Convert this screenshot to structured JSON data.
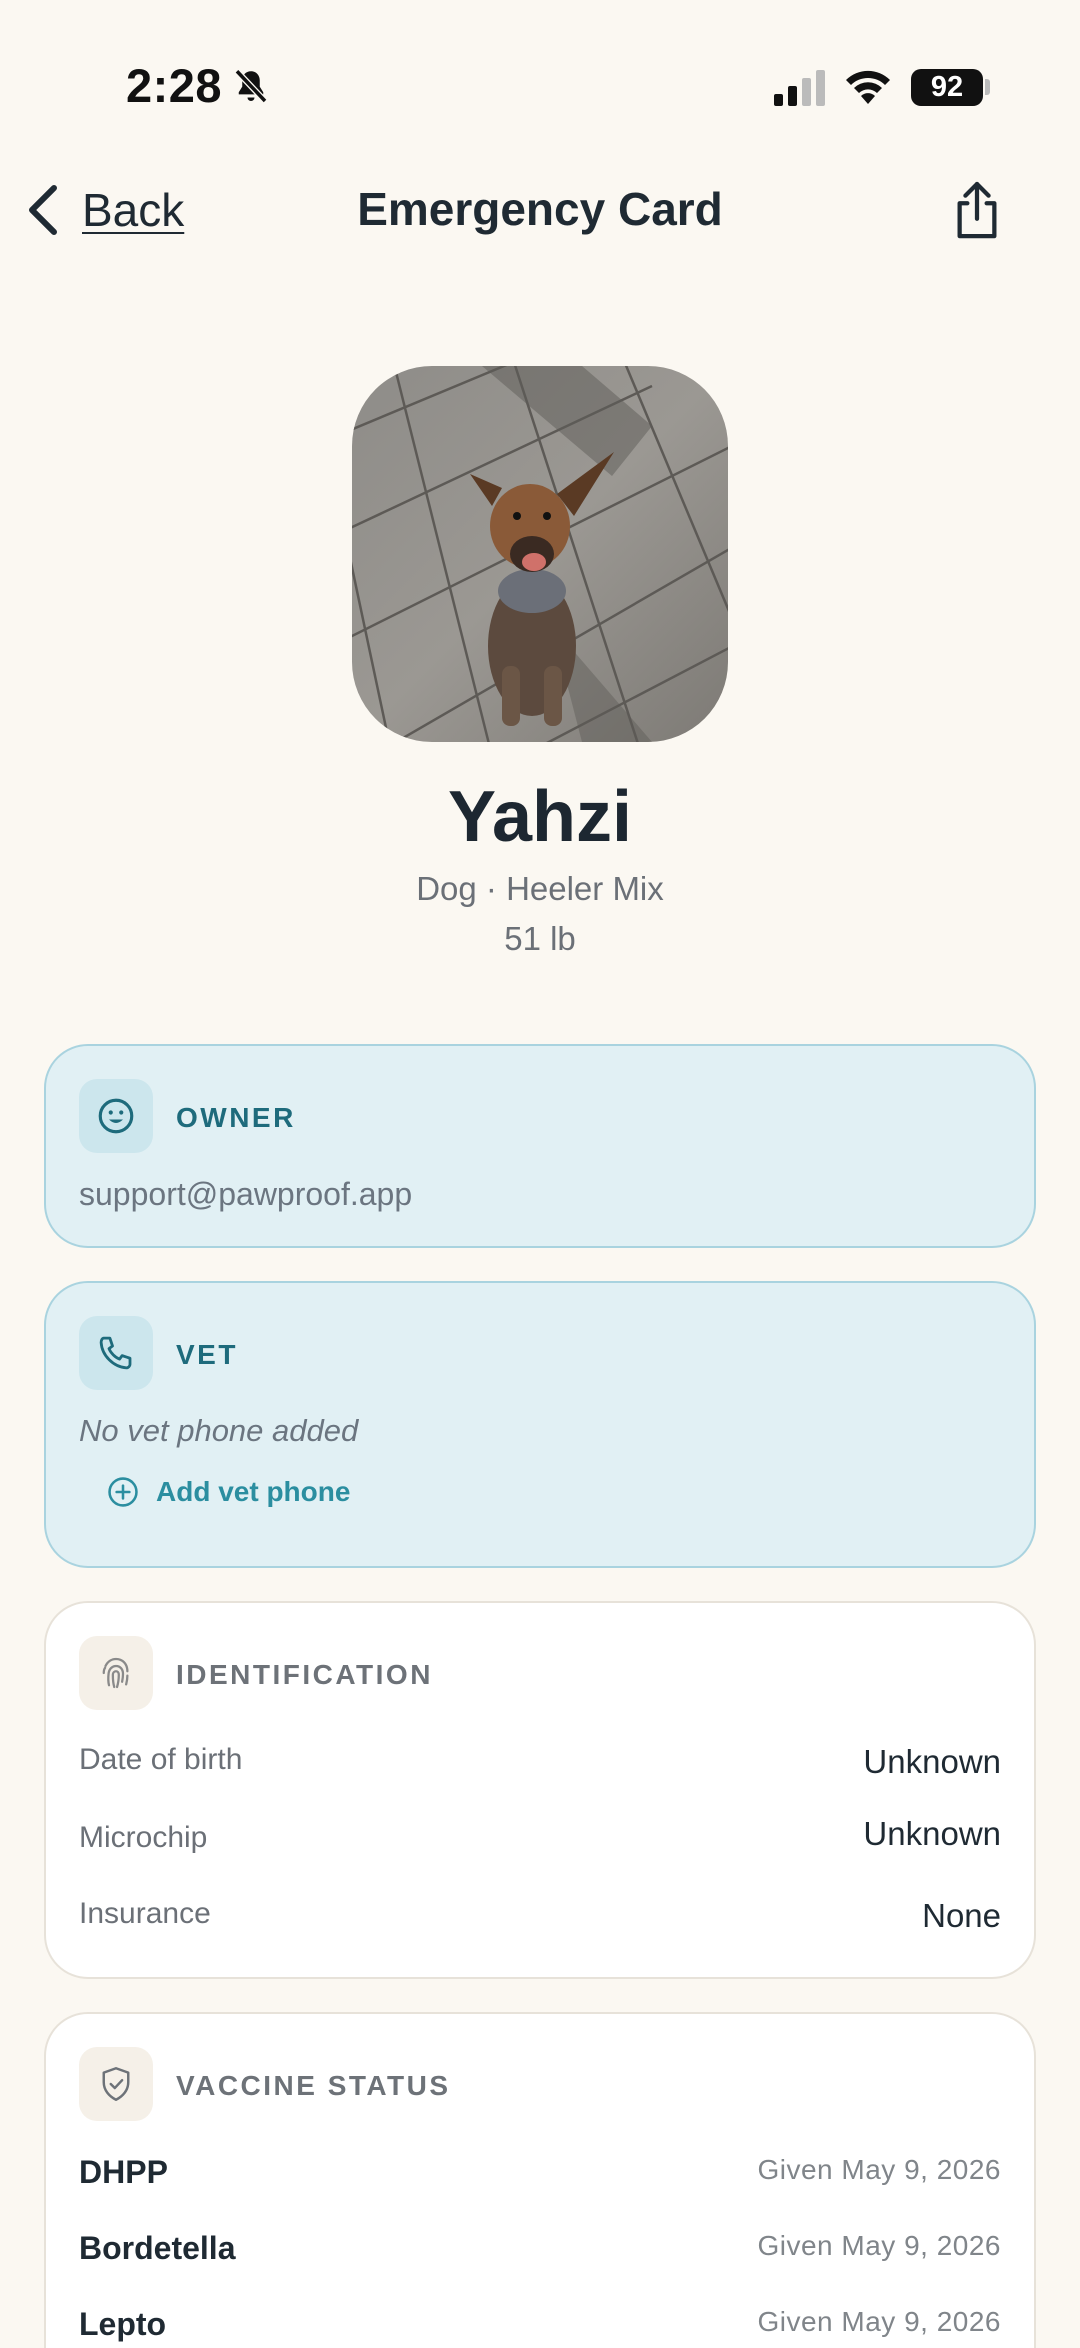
{
  "status_bar": {
    "time": "2:28",
    "battery": "92"
  },
  "nav": {
    "back_label": "Back",
    "title": "Emergency Card"
  },
  "pet": {
    "name": "Yahzi",
    "breed_line": "Dog · Heeler Mix",
    "weight": "51 lb"
  },
  "owner_card": {
    "heading": "OWNER",
    "email": "support@pawproof.app"
  },
  "vet_card": {
    "heading": "VET",
    "empty_text": "No vet phone added",
    "add_label": "Add vet phone"
  },
  "identification_card": {
    "heading": "IDENTIFICATION",
    "rows": [
      {
        "label": "Date of birth",
        "value": "Unknown"
      },
      {
        "label": "Microchip",
        "value": "Unknown"
      },
      {
        "label": "Insurance",
        "value": "None"
      }
    ]
  },
  "vaccine_card": {
    "heading": "VACCINE STATUS",
    "rows": [
      {
        "name": "DHPP",
        "date": "Given May 9, 2026"
      },
      {
        "name": "Bordetella",
        "date": "Given May 9, 2026"
      },
      {
        "name": "Lepto",
        "date": "Given May 9, 2026"
      }
    ]
  },
  "colors": {
    "background": "#fbf8f2",
    "accent_teal": "#2b8ea0",
    "blue_card": "#e1f0f4",
    "blue_card_border": "#a9d3df"
  },
  "icons": [
    "chevron-left-icon",
    "share-icon",
    "smile-icon",
    "phone-icon",
    "plus-circle-icon",
    "fingerprint-icon",
    "shield-check-icon",
    "bell-slash-icon",
    "signal-icon",
    "wifi-icon"
  ]
}
